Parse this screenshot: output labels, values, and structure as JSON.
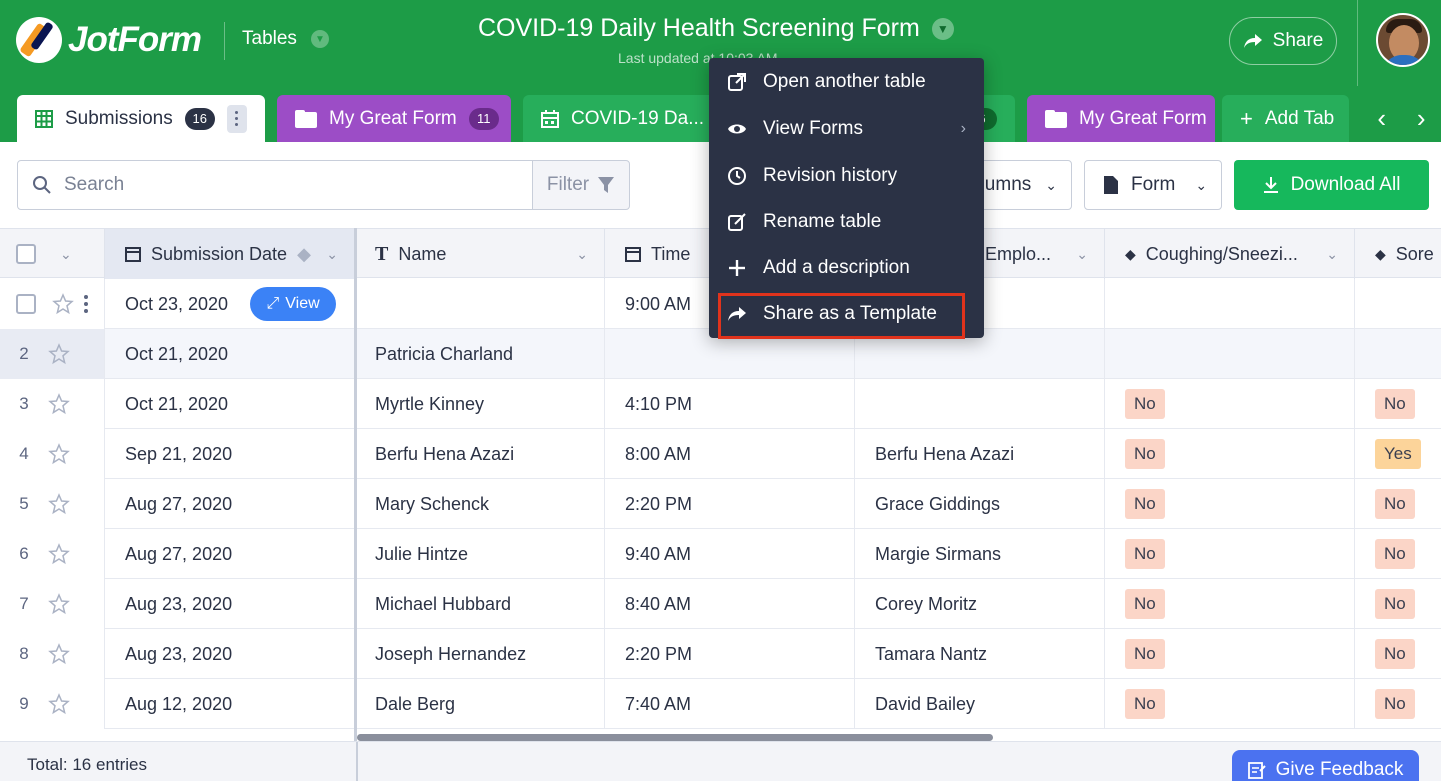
{
  "app": {
    "logo_text": "JotForm",
    "section": "Tables",
    "form_title": "COVID-19 Daily Health Screening Form",
    "last_updated": "Last updated at 10:03 AM",
    "share_label": "Share"
  },
  "tabs": [
    {
      "label": "Submissions",
      "count": "16"
    },
    {
      "label": "My Great Form",
      "count": "11"
    },
    {
      "label": "COVID-19 Da...",
      "count": "6"
    },
    {
      "label": "My Great Form"
    },
    {
      "label": "Add Tab"
    }
  ],
  "toolbar": {
    "search_placeholder": "Search",
    "filter_label": "Filter",
    "columns_label": "Columns",
    "columns_visible": "umns",
    "form_label": "Form",
    "download_label": "Download All"
  },
  "columns": [
    {
      "label": "Submission Date"
    },
    {
      "label": "Name"
    },
    {
      "label": "Time"
    },
    {
      "label": "Emplo..."
    },
    {
      "label": "Coughing/Sneezi..."
    },
    {
      "label": "Sore"
    }
  ],
  "rows": [
    {
      "num": "",
      "date": "Oct 23, 2020",
      "name": "",
      "time": "9:00 AM",
      "employee": "",
      "coughing": "",
      "sore": "",
      "view_label": "View"
    },
    {
      "num": "2",
      "date": "Oct 21, 2020",
      "name": "Patricia Charland",
      "time": "",
      "employee": "",
      "coughing": "",
      "sore": ""
    },
    {
      "num": "3",
      "date": "Oct 21, 2020",
      "name": "Myrtle Kinney",
      "time": "4:10 PM",
      "employee": "",
      "coughing": "No",
      "sore": "No"
    },
    {
      "num": "4",
      "date": "Sep 21, 2020",
      "name": "Berfu Hena Azazi",
      "time": "8:00 AM",
      "employee": "Berfu Hena Azazi",
      "coughing": "No",
      "sore": "Yes"
    },
    {
      "num": "5",
      "date": "Aug 27, 2020",
      "name": "Mary Schenck",
      "time": "2:20 PM",
      "employee": "Grace Giddings",
      "coughing": "No",
      "sore": "No"
    },
    {
      "num": "6",
      "date": "Aug 27, 2020",
      "name": "Julie Hintze",
      "time": "9:40 AM",
      "employee": "Margie Sirmans",
      "coughing": "No",
      "sore": "No"
    },
    {
      "num": "7",
      "date": "Aug 23, 2020",
      "name": "Michael Hubbard",
      "time": "8:40 AM",
      "employee": "Corey Moritz",
      "coughing": "No",
      "sore": "No"
    },
    {
      "num": "8",
      "date": "Aug 23, 2020",
      "name": "Joseph Hernandez",
      "time": "2:20 PM",
      "employee": "Tamara Nantz",
      "coughing": "No",
      "sore": "No"
    },
    {
      "num": "9",
      "date": "Aug 12, 2020",
      "name": "Dale Berg",
      "time": "7:40 AM",
      "employee": "David Bailey",
      "coughing": "No",
      "sore": "No"
    }
  ],
  "footer": {
    "total": "Total: 16 entries",
    "feedback_label": "Give Feedback"
  },
  "menu": [
    {
      "label": "Open another table",
      "icon": "external-link-icon"
    },
    {
      "label": "View Forms",
      "icon": "eye-icon"
    },
    {
      "label": "Revision history",
      "icon": "clock-icon"
    },
    {
      "label": "Rename table",
      "icon": "edit-icon"
    },
    {
      "label": "Add a description",
      "icon": "plus-icon"
    },
    {
      "label": "Share as a Template",
      "icon": "share-arrow-icon"
    }
  ],
  "colors": {
    "brand_green": "#1d9c47",
    "download_green": "#16b85c",
    "purple_tab": "#9c4dc6",
    "menu_bg": "#2b3245",
    "highlight_red": "#e0331c",
    "view_blue": "#3b82f6",
    "badge_no": "#fbd5c7",
    "badge_yes": "#fcd49a"
  }
}
